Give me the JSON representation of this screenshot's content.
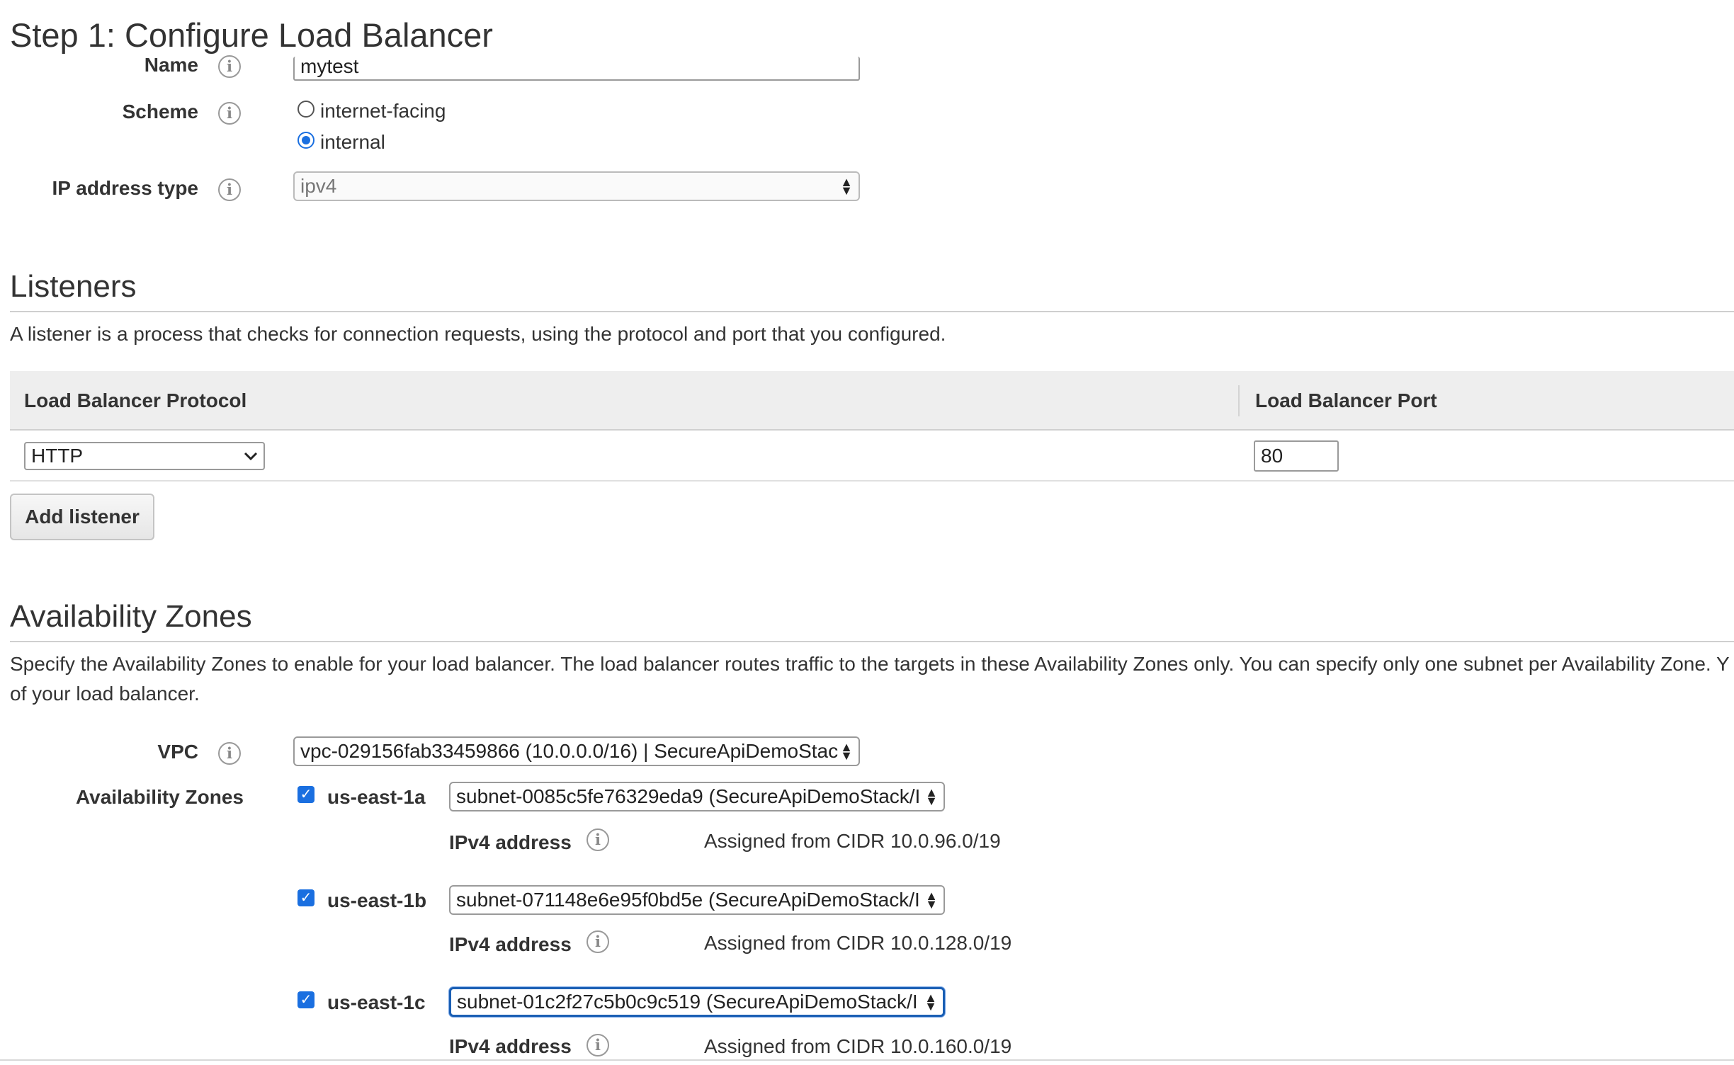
{
  "page": {
    "title": "Step 1: Configure Load Balancer"
  },
  "basic": {
    "name_label": "Name",
    "name_value": "mytest",
    "scheme_label": "Scheme",
    "scheme_options": [
      {
        "label": "internet-facing",
        "selected": false
      },
      {
        "label": "internal",
        "selected": true
      }
    ],
    "ip_label": "IP address type",
    "ip_value": "ipv4"
  },
  "listeners": {
    "heading": "Listeners",
    "description": "A listener is a process that checks for connection requests, using the protocol and port that you configured.",
    "columns": [
      "Load Balancer Protocol",
      "Load Balancer Port"
    ],
    "rows": [
      {
        "protocol": "HTTP",
        "port": "80"
      }
    ],
    "add_button": "Add listener"
  },
  "availability": {
    "heading": "Availability Zones",
    "description_line1": "Specify the Availability Zones to enable for your load balancer. The load balancer routes traffic to the targets in these Availability Zones only. You can specify only one subnet per Availability Zone. Y",
    "description_line2": "of your load balancer.",
    "vpc_label": "VPC",
    "vpc_value": "vpc-029156fab33459866 (10.0.0.0/16) | SecureApiDemoStac",
    "zones_label": "Availability Zones",
    "zones": [
      {
        "name": "us-east-1a",
        "checked": true,
        "subnet": "subnet-0085c5fe76329eda9 (SecureApiDemoStack/I",
        "ipv4_label": "IPv4 address",
        "ipv4_value": "Assigned from CIDR 10.0.96.0/19"
      },
      {
        "name": "us-east-1b",
        "checked": true,
        "subnet": "subnet-071148e6e95f0bd5e (SecureApiDemoStack/I",
        "ipv4_label": "IPv4 address",
        "ipv4_value": "Assigned from CIDR 10.0.128.0/19"
      },
      {
        "name": "us-east-1c",
        "checked": true,
        "subnet": "subnet-01c2f27c5b0c9c519 (SecureApiDemoStack/I",
        "ipv4_label": "IPv4 address",
        "ipv4_value": "Assigned from CIDR 10.0.160.0/19"
      }
    ]
  },
  "colors": {
    "accent": "#1a6fe0",
    "focus": "#1a5fb4",
    "table_header": "#eeeeee"
  }
}
